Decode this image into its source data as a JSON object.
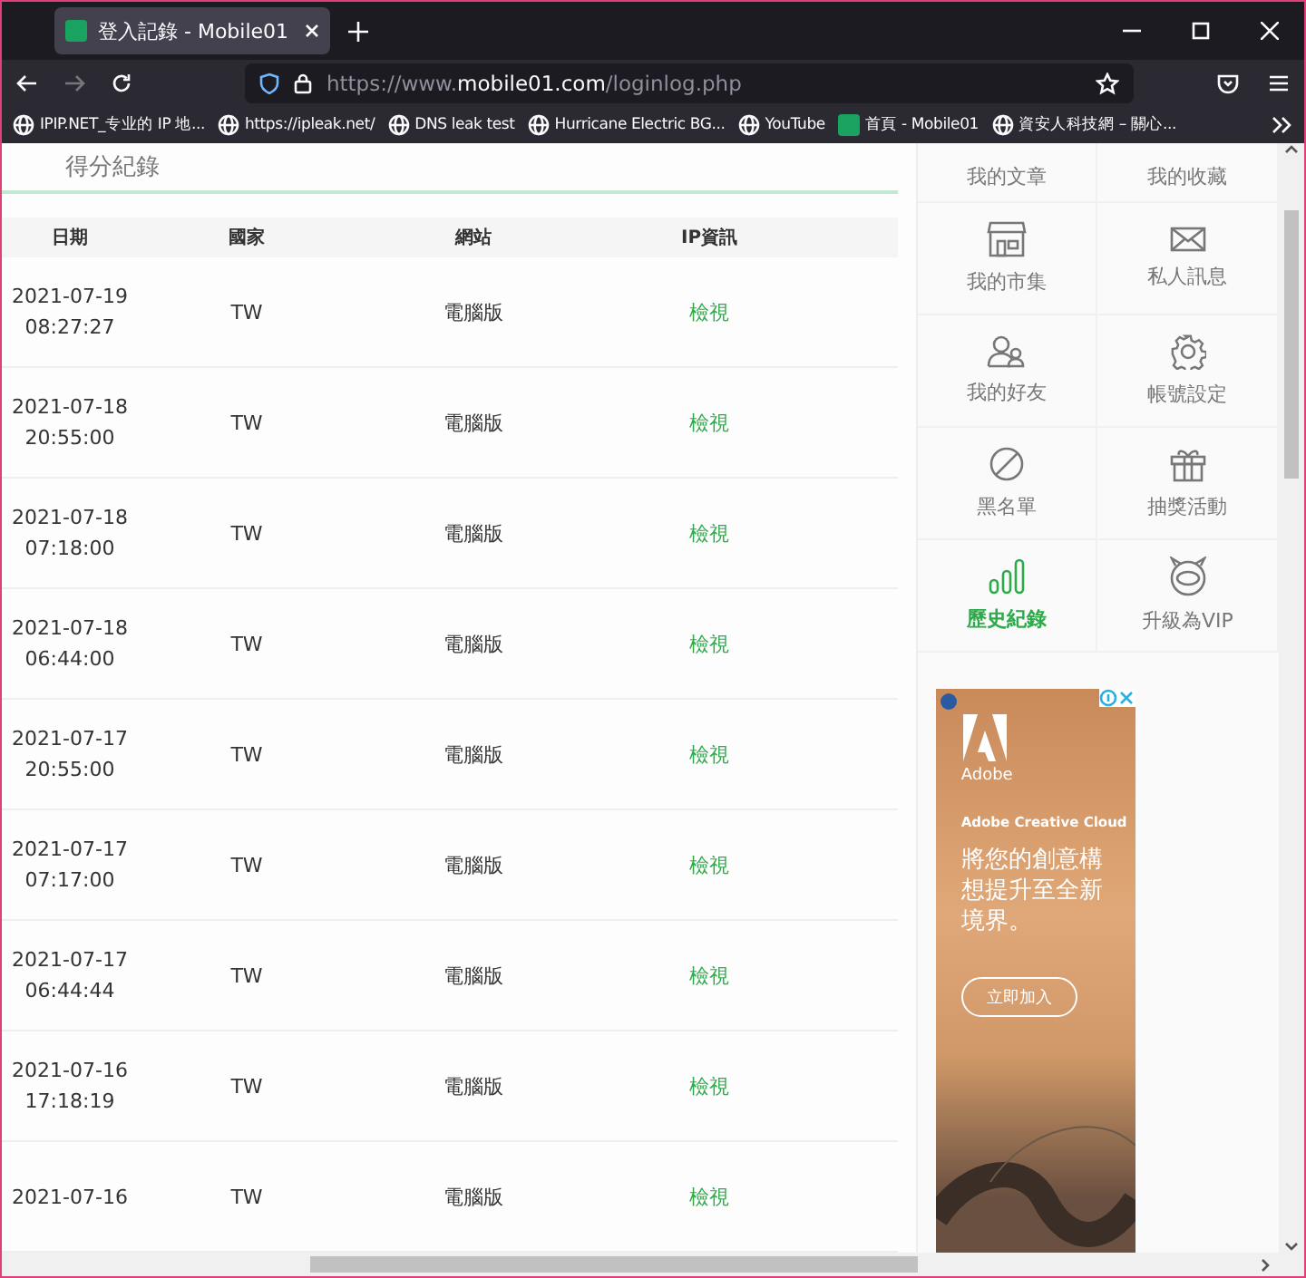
{
  "window": {
    "tab_title": "登入記錄 - Mobile01",
    "url_prefix": "https://www.",
    "url_domain": "mobile01.com",
    "url_path": "/loginlog.php"
  },
  "bookmarks": [
    {
      "label": "IPIP.NET_专业的 IP 地...",
      "kind": "globe"
    },
    {
      "label": "https://ipleak.net/",
      "kind": "globe"
    },
    {
      "label": "DNS leak test",
      "kind": "globe"
    },
    {
      "label": "Hurricane Electric BG...",
      "kind": "globe"
    },
    {
      "label": "YouTube",
      "kind": "globe"
    },
    {
      "label": "首頁 - Mobile01",
      "kind": "site"
    },
    {
      "label": "資安人科技網 – 關心...",
      "kind": "globe"
    }
  ],
  "section_title": "得分紀錄",
  "table": {
    "columns": [
      "日期",
      "國家",
      "網站",
      "IP資訊"
    ],
    "rows": [
      {
        "date": "2021-07-19",
        "time": "08:27:27",
        "country": "TW",
        "site": "電腦版",
        "ip": "檢視"
      },
      {
        "date": "2021-07-18",
        "time": "20:55:00",
        "country": "TW",
        "site": "電腦版",
        "ip": "檢視"
      },
      {
        "date": "2021-07-18",
        "time": "07:18:00",
        "country": "TW",
        "site": "電腦版",
        "ip": "檢視"
      },
      {
        "date": "2021-07-18",
        "time": "06:44:00",
        "country": "TW",
        "site": "電腦版",
        "ip": "檢視"
      },
      {
        "date": "2021-07-17",
        "time": "20:55:00",
        "country": "TW",
        "site": "電腦版",
        "ip": "檢視"
      },
      {
        "date": "2021-07-17",
        "time": "07:17:00",
        "country": "TW",
        "site": "電腦版",
        "ip": "檢視"
      },
      {
        "date": "2021-07-17",
        "time": "06:44:44",
        "country": "TW",
        "site": "電腦版",
        "ip": "檢視"
      },
      {
        "date": "2021-07-16",
        "time": "17:18:19",
        "country": "TW",
        "site": "電腦版",
        "ip": "檢視"
      },
      {
        "date": "2021-07-16",
        "country": "TW",
        "site": "電腦版",
        "ip": "檢視"
      }
    ]
  },
  "sidebar": {
    "items": [
      {
        "label": "我的文章",
        "kind": "none",
        "selected": false
      },
      {
        "label": "我的收藏",
        "kind": "none",
        "selected": false
      },
      {
        "label": "我的市集",
        "kind": "store",
        "selected": false
      },
      {
        "label": "私人訊息",
        "kind": "mail",
        "selected": false
      },
      {
        "label": "我的好友",
        "kind": "friends",
        "selected": false
      },
      {
        "label": "帳號設定",
        "kind": "gear",
        "selected": false
      },
      {
        "label": "黑名單",
        "kind": "ban",
        "selected": false
      },
      {
        "label": "抽獎活動",
        "kind": "gift",
        "selected": false
      },
      {
        "label": "歷史紀錄",
        "kind": "chart",
        "selected": true
      },
      {
        "label": "升級為VIP",
        "kind": "vip",
        "selected": false
      }
    ]
  },
  "ad": {
    "brand": "Adobe",
    "product": "Adobe Creative Cloud",
    "headline": "將您的創意構想提升至全新境界。",
    "button": "立即加入"
  }
}
